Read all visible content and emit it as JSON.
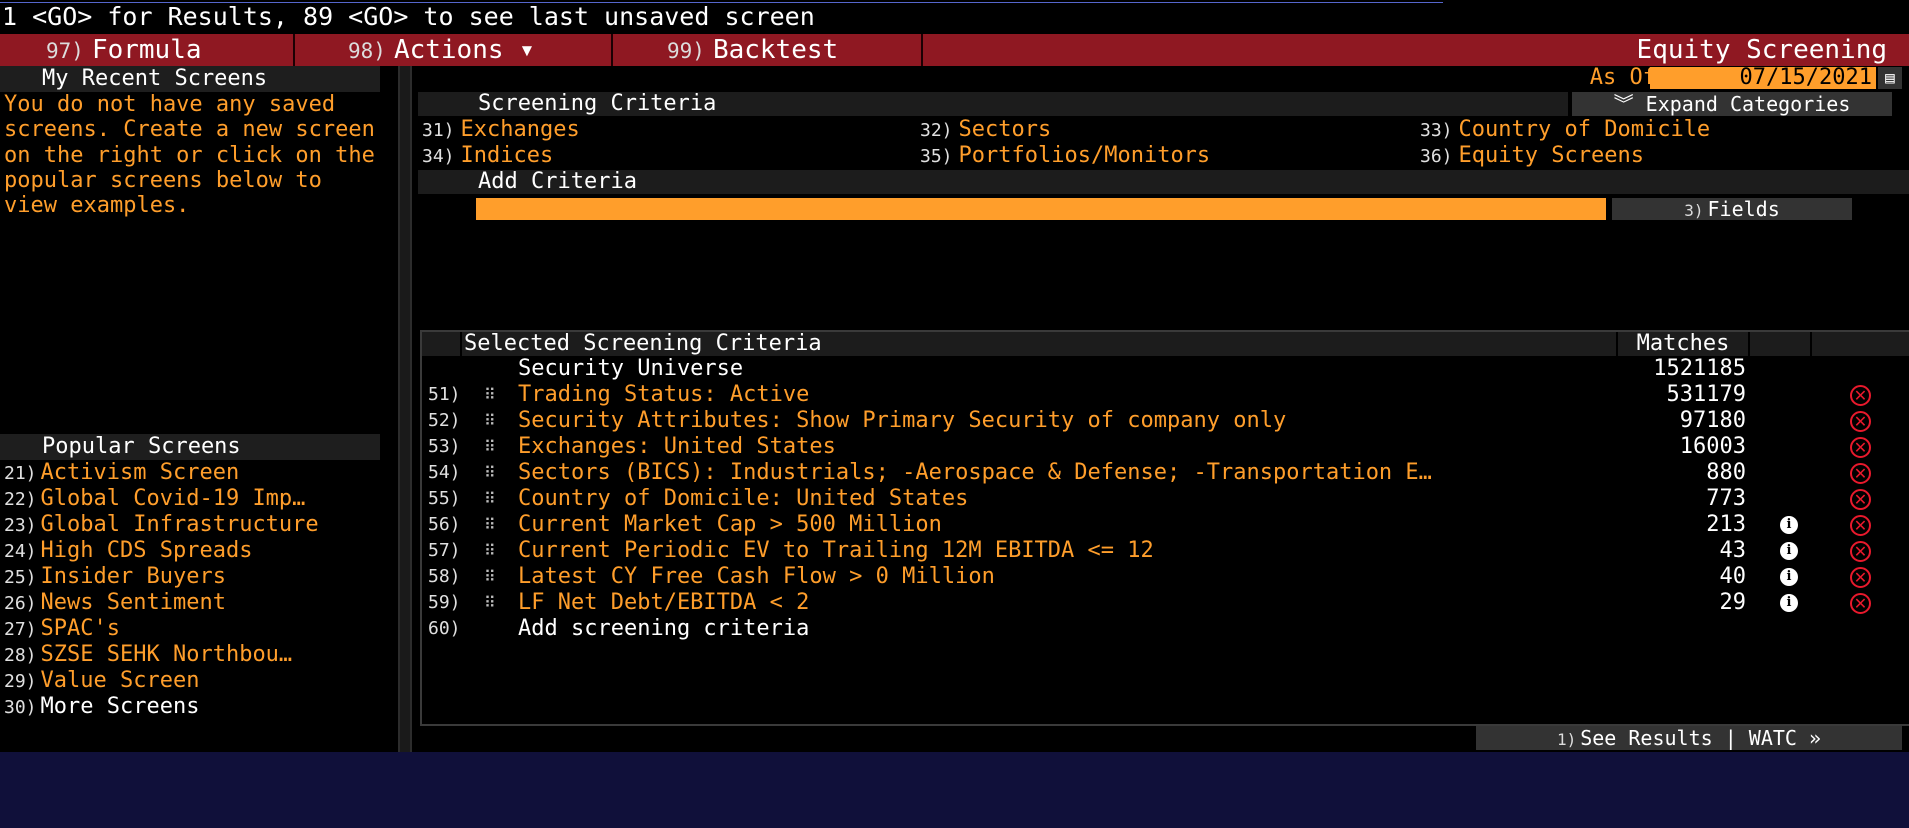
{
  "command_line": "1 <GO> for Results, 89 <GO> to see last unsaved screen",
  "menu": {
    "tabs": [
      {
        "num": "97)",
        "label": "Formula"
      },
      {
        "num": "98)",
        "label": "Actions ▾"
      },
      {
        "num": "99)",
        "label": "Backtest"
      }
    ],
    "title": "Equity Screening"
  },
  "left": {
    "recent_header": "My Recent Screens",
    "recent_message": "You do not have any saved screens. Create a new screen on the right or click on the popular screens below to view examples.",
    "popular_header": "Popular Screens",
    "popular": [
      {
        "num": "21)",
        "label": "Activism Screen"
      },
      {
        "num": "22)",
        "label": "Global Covid-19 Imp…"
      },
      {
        "num": "23)",
        "label": "Global Infrastructure"
      },
      {
        "num": "24)",
        "label": "High CDS Spreads"
      },
      {
        "num": "25)",
        "label": "Insider Buyers"
      },
      {
        "num": "26)",
        "label": "News Sentiment"
      },
      {
        "num": "27)",
        "label": "SPAC's"
      },
      {
        "num": "28)",
        "label": "SZSE SEHK Northbou…"
      },
      {
        "num": "29)",
        "label": "Value Screen"
      },
      {
        "num": "30)",
        "label": "More Screens"
      }
    ]
  },
  "as_of": {
    "label": "As Of",
    "date": "07/15/2021"
  },
  "screening_criteria": {
    "header": "Screening Criteria",
    "expand_label": "Expand Categories",
    "items": [
      {
        "num": "31)",
        "label": "Exchanges"
      },
      {
        "num": "32)",
        "label": "Sectors"
      },
      {
        "num": "33)",
        "label": "Country of Domicile"
      },
      {
        "num": "34)",
        "label": "Indices"
      },
      {
        "num": "35)",
        "label": "Portfolios/Monitors"
      },
      {
        "num": "36)",
        "label": "Equity Screens"
      }
    ]
  },
  "add_criteria": {
    "header": "Add Criteria",
    "fields_num": "3)",
    "fields_label": "Fields"
  },
  "selected": {
    "header": "Selected Screening Criteria",
    "matches_header": "Matches",
    "rows": [
      {
        "num": "",
        "label": "Security Universe",
        "count": "1521185"
      },
      {
        "num": "51)",
        "label": "Trading Status: Active",
        "count": "531179"
      },
      {
        "num": "52)",
        "label": "Security Attributes: Show Primary Security of company only",
        "count": "97180"
      },
      {
        "num": "53)",
        "label": "Exchanges: United States",
        "count": "16003"
      },
      {
        "num": "54)",
        "label": "Sectors (BICS): Industrials; -Aerospace & Defense; -Transportation E…",
        "count": "880"
      },
      {
        "num": "55)",
        "label": "Country of Domicile: United States",
        "count": "773"
      },
      {
        "num": "56)",
        "label": "Current Market Cap > 500 Million",
        "count": "213"
      },
      {
        "num": "57)",
        "label": "Current Periodic EV to Trailing 12M EBITDA <= 12",
        "count": "43"
      },
      {
        "num": "58)",
        "label": "Latest CY Free Cash Flow > 0 Million",
        "count": "40"
      },
      {
        "num": "59)",
        "label": "LF Net Debt/EBITDA < 2",
        "count": "29"
      },
      {
        "num": "60)",
        "label": "Add screening criteria",
        "count": ""
      }
    ]
  },
  "see_results": {
    "num": "1)",
    "label": "See Results | WATC »"
  },
  "colors": {
    "accent": "#ff9e2b",
    "menu_bar": "#8f1822",
    "delete": "#e8192c",
    "footer": "#10103a"
  }
}
